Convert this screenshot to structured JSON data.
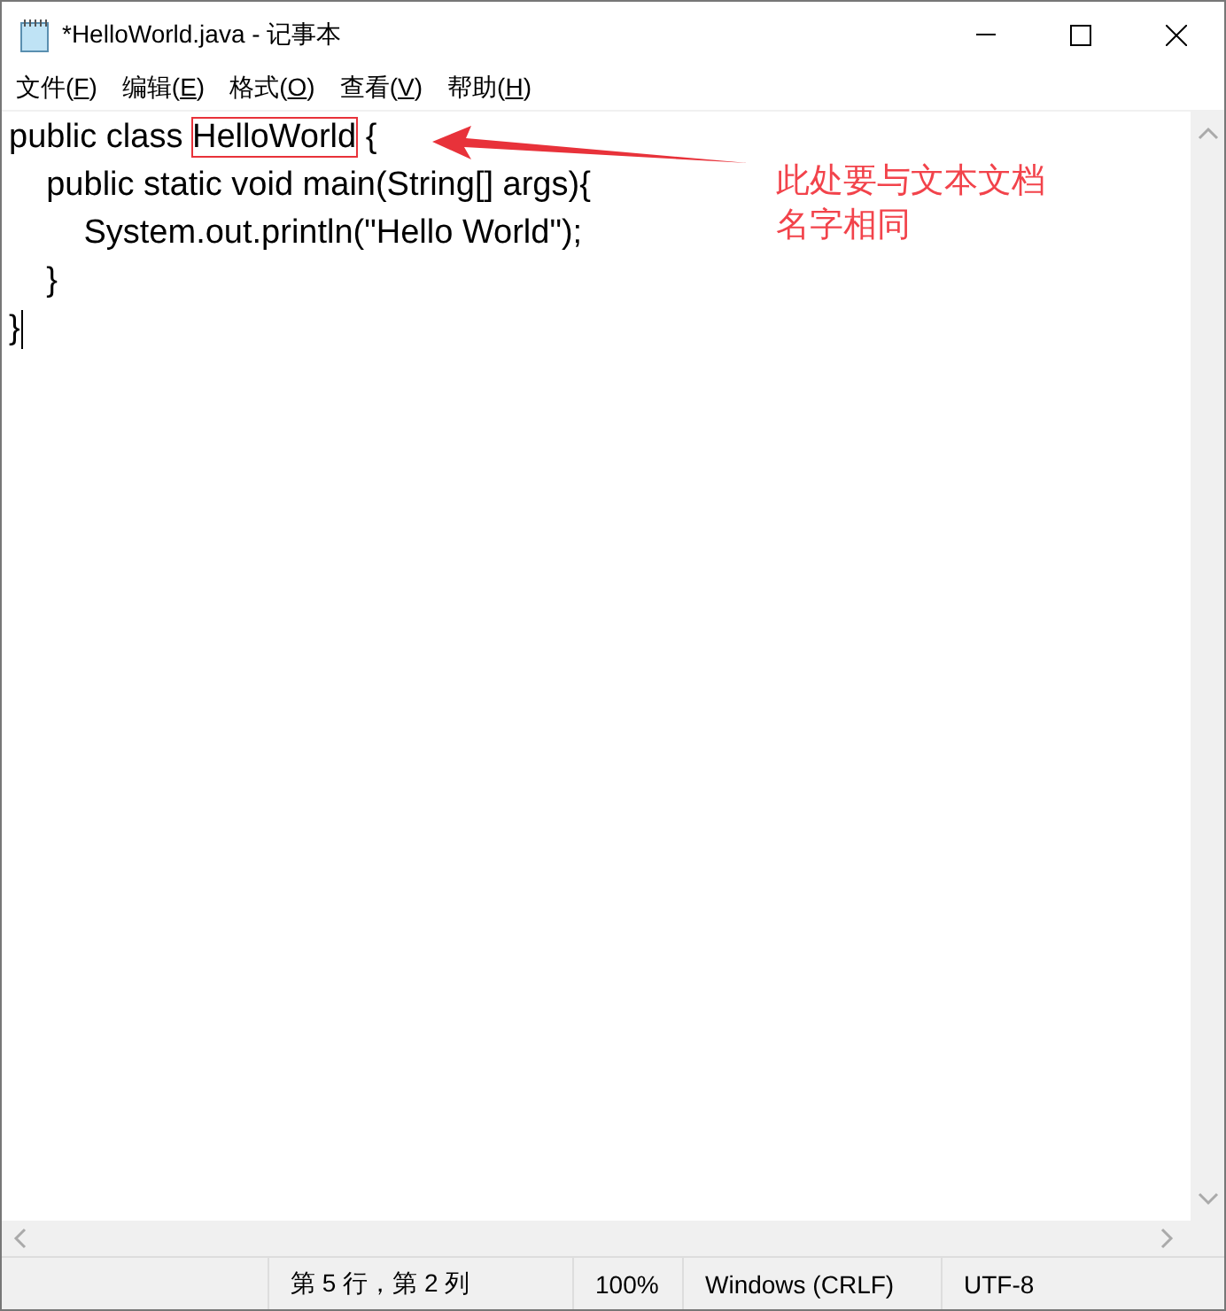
{
  "window": {
    "title": "*HelloWorld.java - 记事本"
  },
  "menu": [
    "文件(F)",
    "编辑(E)",
    "格式(O)",
    "查看(V)",
    "帮助(H)"
  ],
  "editor": {
    "lines": [
      {
        "text": "public class ",
        "boxed": "HelloWorld",
        "rest": " {",
        "caret": false
      },
      {
        "text": "    public static void main(String[] args){",
        "caret": false
      },
      {
        "text": "        System.out.println(\"Hello World\");",
        "caret": false
      },
      {
        "text": "    }",
        "caret": false
      },
      {
        "text": "}",
        "caret": true
      }
    ]
  },
  "annotation": {
    "note": [
      "此处要与文本文档",
      "名字相同"
    ]
  },
  "status_bar": [
    "第 5 行，第 2 列",
    "100%",
    "Windows (CRLF)",
    "UTF-8"
  ]
}
